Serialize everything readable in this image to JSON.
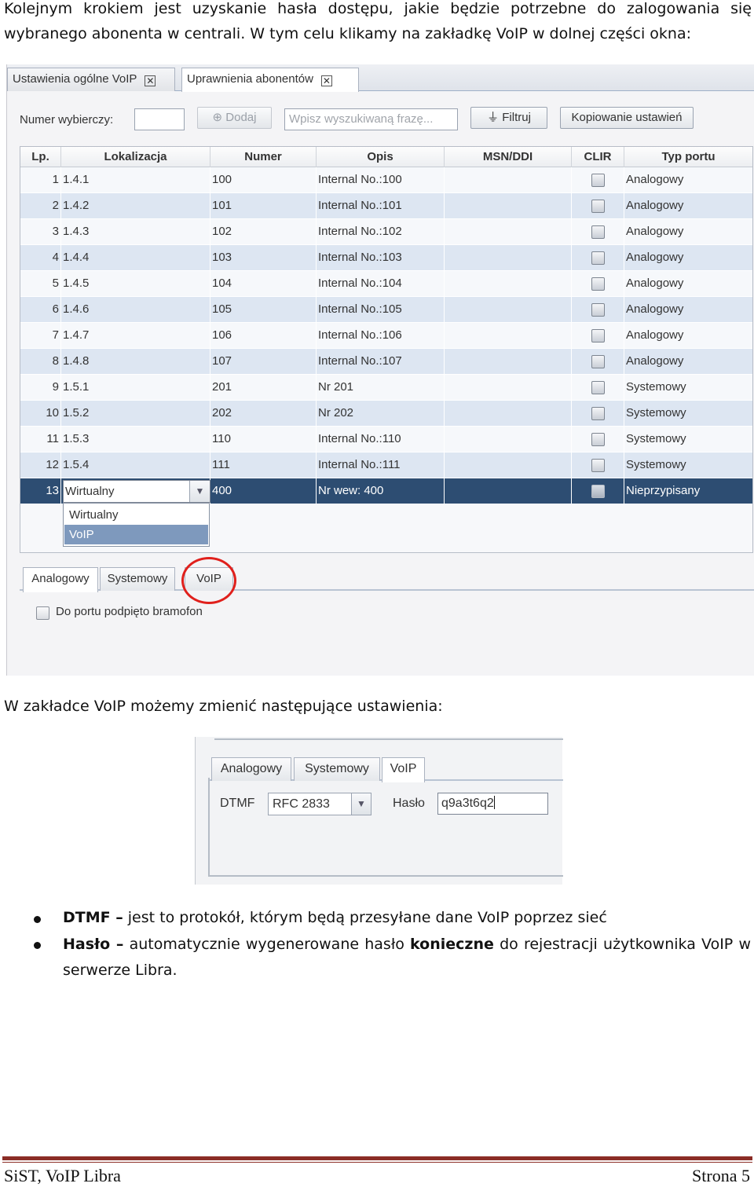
{
  "intro": {
    "line1": "Kolejnym krokiem jest uzyskanie hasła dostępu, jakie będzie potrzebne do zalogowania się",
    "line2": "wybranego abonenta w centrali. W tym celu klikamy na zakładkę VoIP w dolnej części okna:"
  },
  "screenshot1": {
    "tabs": [
      "Ustawienia ogólne VoIP",
      "Uprawnienia abonentów"
    ],
    "active_tab": "Uprawnienia abonentów",
    "toolbar": {
      "number_label": "Numer wybierczy:",
      "number_value": "",
      "add_button": "Dodaj",
      "search_placeholder": "Wpisz wyszukiwaną frazę...",
      "filter_button": "Filtruj",
      "copy_button": "Kopiowanie ustawień"
    },
    "columns": [
      "Lp.",
      "Lokalizacja",
      "Numer",
      "Opis",
      "MSN/DDI",
      "CLIR",
      "Typ portu"
    ],
    "rows": [
      {
        "lp": "1",
        "lok": "1.4.1",
        "num": "100",
        "opis": "Internal No.:100",
        "msn": "",
        "typ": "Analogowy"
      },
      {
        "lp": "2",
        "lok": "1.4.2",
        "num": "101",
        "opis": "Internal No.:101",
        "msn": "",
        "typ": "Analogowy"
      },
      {
        "lp": "3",
        "lok": "1.4.3",
        "num": "102",
        "opis": "Internal No.:102",
        "msn": "",
        "typ": "Analogowy"
      },
      {
        "lp": "4",
        "lok": "1.4.4",
        "num": "103",
        "opis": "Internal No.:103",
        "msn": "",
        "typ": "Analogowy"
      },
      {
        "lp": "5",
        "lok": "1.4.5",
        "num": "104",
        "opis": "Internal No.:104",
        "msn": "",
        "typ": "Analogowy"
      },
      {
        "lp": "6",
        "lok": "1.4.6",
        "num": "105",
        "opis": "Internal No.:105",
        "msn": "",
        "typ": "Analogowy"
      },
      {
        "lp": "7",
        "lok": "1.4.7",
        "num": "106",
        "opis": "Internal No.:106",
        "msn": "",
        "typ": "Analogowy"
      },
      {
        "lp": "8",
        "lok": "1.4.8",
        "num": "107",
        "opis": "Internal No.:107",
        "msn": "",
        "typ": "Analogowy"
      },
      {
        "lp": "9",
        "lok": "1.5.1",
        "num": "201",
        "opis": "Nr 201",
        "msn": "",
        "typ": "Systemowy"
      },
      {
        "lp": "10",
        "lok": "1.5.2",
        "num": "202",
        "opis": "Nr 202",
        "msn": "",
        "typ": "Systemowy"
      },
      {
        "lp": "11",
        "lok": "1.5.3",
        "num": "110",
        "opis": "Internal No.:110",
        "msn": "",
        "typ": "Systemowy"
      },
      {
        "lp": "12",
        "lok": "1.5.4",
        "num": "111",
        "opis": "Internal No.:111",
        "msn": "",
        "typ": "Systemowy"
      },
      {
        "lp": "13",
        "lok": "Wirtualny",
        "num": "400",
        "opis": "Nr wew: 400",
        "msn": "",
        "typ": "Nieprzypisany"
      }
    ],
    "dropdown_options": [
      "Wirtualny",
      "VoIP"
    ],
    "dropdown_highlighted": "VoIP",
    "bottom_tabs": [
      "Analogowy",
      "Systemowy",
      "VoIP"
    ],
    "bottom_active_tab": "Analogowy",
    "highlight_color": "#e0201c",
    "checkbox_label": "Do portu podpięto bramofon"
  },
  "para2": "W zakładce VoIP możemy zmienić następujące ustawienia:",
  "screenshot2": {
    "tabs": [
      "Analogowy",
      "Systemowy",
      "VoIP"
    ],
    "active_tab": "VoIP",
    "dtmf_label": "DTMF",
    "dtmf_value": "RFC 2833",
    "haslo_label": "Hasło",
    "haslo_value": "q9a3t6q2"
  },
  "bullets": [
    {
      "term": "DTMF –",
      "text": " jest to protokół, którym będą przesyłane dane VoIP poprzez sieć"
    },
    {
      "term": "Hasło –",
      "text_before": " automatycznie wygenerowane hasło ",
      "bold": "konieczne",
      "text_after": " do rejestracji użytkownika VoIP w serwerze Libra."
    }
  ],
  "footer": {
    "left": "SiST, VoIP Libra",
    "right": "Strona 5",
    "rule_color": "#8b2d26"
  }
}
